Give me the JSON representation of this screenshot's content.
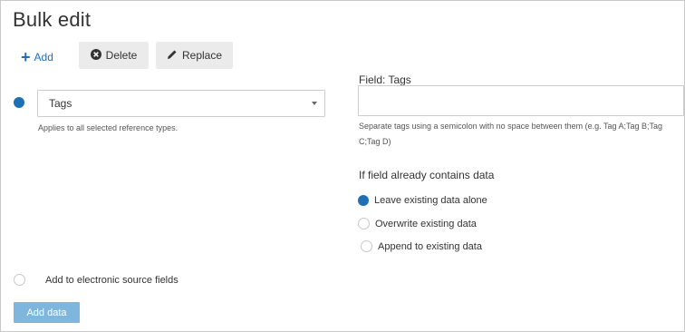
{
  "page": {
    "title": "Bulk edit"
  },
  "toolbar": {
    "add_label": "Add",
    "delete_label": "Delete",
    "replace_label": "Replace"
  },
  "row": {
    "selected_field": "Tags",
    "helper": "Applies to all selected reference types."
  },
  "field_panel": {
    "label": "Field: Tags",
    "value": "",
    "help": "Separate tags using a semicolon with no space between them (e.g. Tag A;Tag B;Tag C;Tag D)",
    "contains_heading": "If field already contains data",
    "options": [
      {
        "label": "Leave existing data alone",
        "selected": true
      },
      {
        "label": "Overwrite existing data",
        "selected": false
      },
      {
        "label": "Append to existing data",
        "selected": false
      }
    ]
  },
  "electronic_source": {
    "label": "Add to electronic source fields",
    "checked": false
  },
  "footer": {
    "add_data_label": "Add data"
  },
  "colors": {
    "accent": "#1f6fb5",
    "button_disabled": "#7fb6de"
  }
}
